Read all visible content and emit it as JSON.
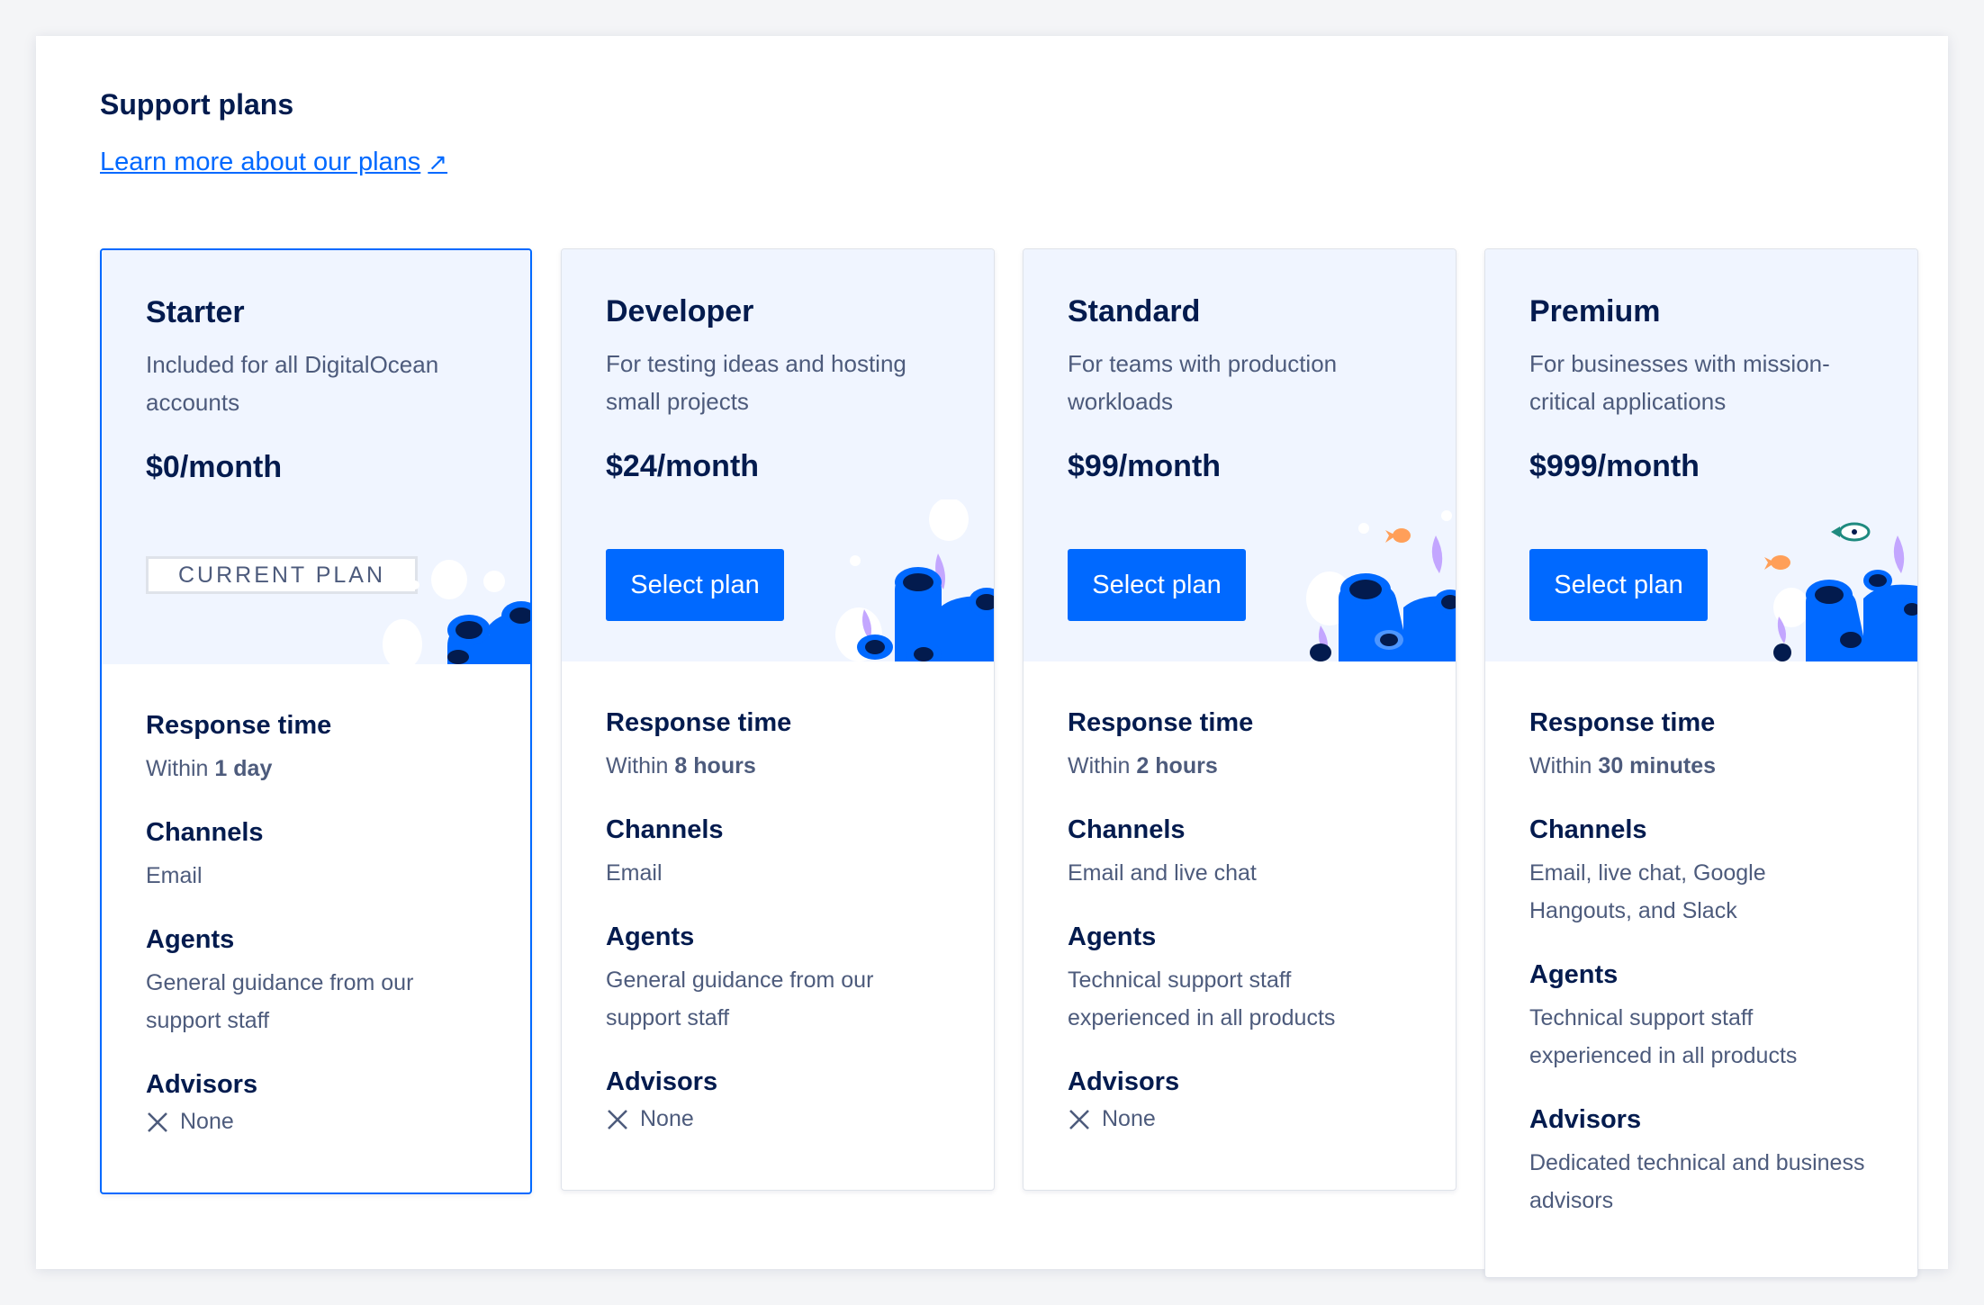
{
  "page": {
    "title": "Support plans",
    "learn_link": "Learn more about our plans",
    "learn_link_icon": "external-arrow-icon"
  },
  "colors": {
    "primary": "#0069ff",
    "heading": "#031b4e",
    "muted": "#4d5b7c",
    "card_top_bg": "#f0f5ff",
    "coral_dark": "#031b4e",
    "coral_blue": "#0069ff",
    "coral_purple": "#c3a6ff",
    "fish_orange": "#ff9f59"
  },
  "plans": [
    {
      "name": "Starter",
      "description": "Included for all DigitalOcean accounts",
      "price": "$0/month",
      "current_badge": "CURRENT PLAN",
      "response_label": "Response time",
      "response_prefix": "Within",
      "response_value": "1 day",
      "channels_label": "Channels",
      "channels_value": "Email",
      "agents_label": "Agents",
      "agents_value": "General guidance from our support staff",
      "advisors_label": "Advisors",
      "advisors_value": "None"
    },
    {
      "name": "Developer",
      "description": "For testing ideas and hosting small projects",
      "price": "$24/month",
      "button": "Select plan",
      "response_label": "Response time",
      "response_prefix": "Within",
      "response_value": "8 hours",
      "channels_label": "Channels",
      "channels_value": "Email",
      "agents_label": "Agents",
      "agents_value": "General guidance from our support staff",
      "advisors_label": "Advisors",
      "advisors_value": "None"
    },
    {
      "name": "Standard",
      "description": "For teams with production workloads",
      "price": "$99/month",
      "button": "Select plan",
      "response_label": "Response time",
      "response_prefix": "Within",
      "response_value": "2 hours",
      "channels_label": "Channels",
      "channels_value": "Email and live chat",
      "agents_label": "Agents",
      "agents_value": "Technical support staff experienced in all products",
      "advisors_label": "Advisors",
      "advisors_value": "None"
    },
    {
      "name": "Premium",
      "description": "For businesses with mission-critical applications",
      "price": "$999/month",
      "button": "Select plan",
      "response_label": "Response time",
      "response_prefix": "Within",
      "response_value": "30 minutes",
      "channels_label": "Channels",
      "channels_value": "Email, live chat, Google Hangouts, and Slack",
      "agents_label": "Agents",
      "agents_value": "Technical support staff experienced in all products",
      "advisors_label": "Advisors",
      "advisors_value": "Dedicated technical and business advisors"
    }
  ]
}
